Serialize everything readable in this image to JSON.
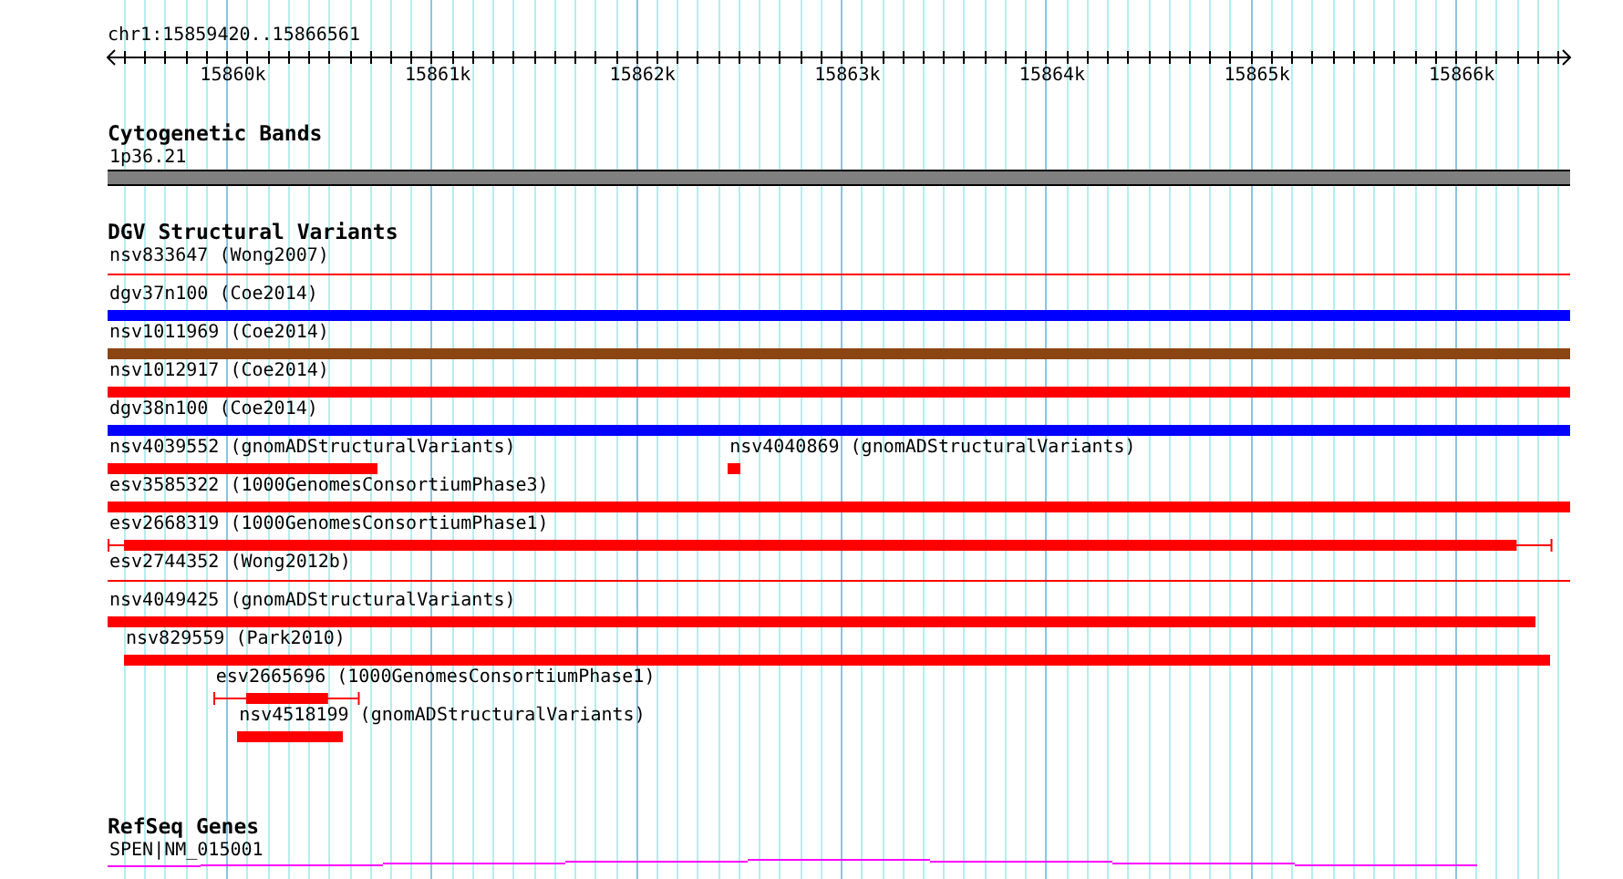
{
  "ruler": {
    "position": "chr1:15859420..15866561",
    "ticks": [
      "15860k",
      "15861k",
      "15862k",
      "15863k",
      "15864k",
      "15865k",
      "15866k"
    ]
  },
  "tracks": [
    {
      "title": "Cytogenetic Bands",
      "kind": "bands",
      "rows": [
        {
          "features": [
            {
              "label": "1p36.21",
              "kind": "band"
            }
          ]
        }
      ]
    },
    {
      "title": "DGV Structural Variants",
      "kind": "variants",
      "rows": [
        {
          "features": [
            {
              "label": "nsv833647 (Wong2007)",
              "kind": "line",
              "color": "#ff0000"
            }
          ]
        },
        {
          "features": [
            {
              "label": "dgv37n100 (Coe2014)",
              "kind": "bar",
              "color": "#0000ff"
            }
          ]
        },
        {
          "features": [
            {
              "label": "nsv1011969 (Coe2014)",
              "kind": "bar",
              "color": "#8b4513"
            }
          ]
        },
        {
          "features": [
            {
              "label": "nsv1012917 (Coe2014)",
              "kind": "bar",
              "color": "#ff0000"
            }
          ]
        },
        {
          "features": [
            {
              "label": "dgv38n100 (Coe2014)",
              "kind": "bar",
              "color": "#0000ff"
            }
          ]
        },
        {
          "features": [
            {
              "label": "nsv4039552 (gnomADStructuralVariants)",
              "kind": "bar",
              "color": "#ff0000"
            },
            {
              "label": "nsv4040869 (gnomADStructuralVariants)",
              "kind": "bar",
              "color": "#ff0000"
            }
          ]
        },
        {
          "features": [
            {
              "label": "esv3585322 (1000GenomesConsortiumPhase3)",
              "kind": "bar",
              "color": "#ff0000"
            }
          ]
        },
        {
          "features": [
            {
              "label": "esv2668319 (1000GenomesConsortiumPhase1)",
              "kind": "whisker",
              "color": "#ff0000"
            }
          ]
        },
        {
          "features": [
            {
              "label": "esv2744352 (Wong2012b)",
              "kind": "line",
              "color": "#ff0000"
            }
          ]
        },
        {
          "features": [
            {
              "label": "nsv4049425 (gnomADStructuralVariants)",
              "kind": "bar",
              "color": "#ff0000"
            }
          ]
        },
        {
          "features": [
            {
              "label": "nsv829559 (Park2010)",
              "kind": "bar",
              "color": "#ff0000"
            }
          ]
        },
        {
          "features": [
            {
              "label": "esv2665696 (1000GenomesConsortiumPhase1)",
              "kind": "whisker",
              "color": "#ff0000"
            }
          ]
        },
        {
          "features": [
            {
              "label": "nsv4518199 (gnomADStructuralVariants)",
              "kind": "bar",
              "color": "#ff0000"
            }
          ]
        }
      ]
    },
    {
      "title": "RefSeq Genes",
      "kind": "genes",
      "rows": [
        {
          "features": [
            {
              "label": "SPEN|NM_015001",
              "kind": "gene"
            }
          ]
        }
      ]
    }
  ]
}
